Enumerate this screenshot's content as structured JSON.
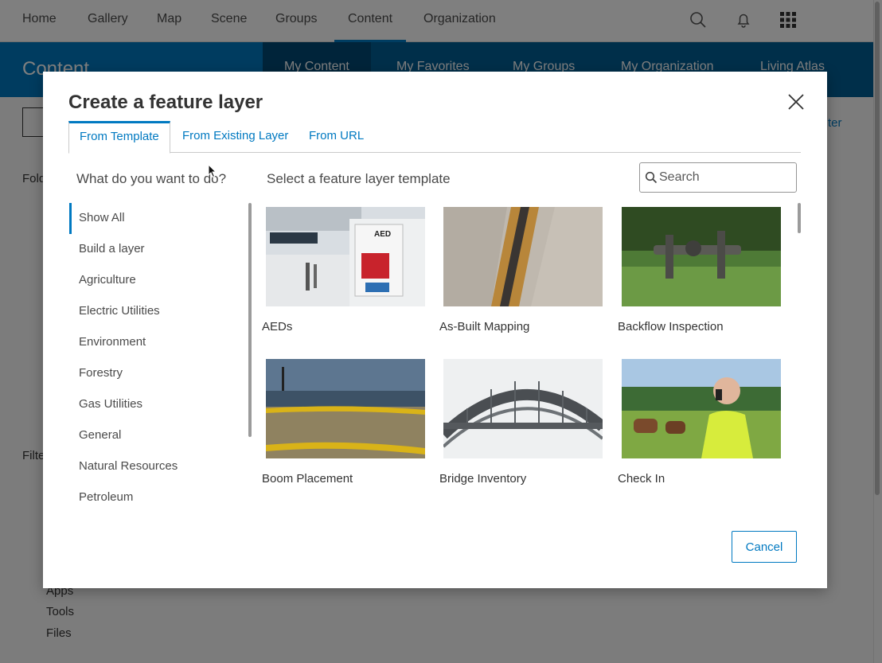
{
  "app": {
    "nav": [
      "Home",
      "Gallery",
      "Map",
      "Scene",
      "Groups",
      "Content",
      "Organization"
    ],
    "banner_title": "Content",
    "banner_tabs": [
      "My Content",
      "My Favorites",
      "My Groups",
      "My Organization",
      "Living Atlas"
    ],
    "side_fragments": {
      "folders": "Fold",
      "filters": "Filte",
      "create_fragment": "ter"
    },
    "side_links": [
      "Apps",
      "Tools",
      "Files"
    ]
  },
  "modal": {
    "title": "Create a feature layer",
    "tabs": [
      "From Template",
      "From Existing Layer",
      "From URL"
    ],
    "active_tab": "From Template",
    "question": "What do you want to do?",
    "subhead": "Select a feature layer template",
    "search_placeholder": "Search",
    "categories": [
      "Show All",
      "Build a layer",
      "Agriculture",
      "Electric Utilities",
      "Environment",
      "Forestry",
      "Gas Utilities",
      "General",
      "Natural Resources",
      "Petroleum"
    ],
    "active_category": "Show All",
    "templates": [
      "AEDs",
      "As-Built Mapping",
      "Backflow Inspection",
      "Boom Placement",
      "Bridge Inventory",
      "Check In"
    ],
    "cancel_label": "Cancel"
  },
  "colors": {
    "accent": "#0079c1",
    "banner": "#0079c1",
    "overlay": "rgba(0,0,0,0.5)"
  }
}
